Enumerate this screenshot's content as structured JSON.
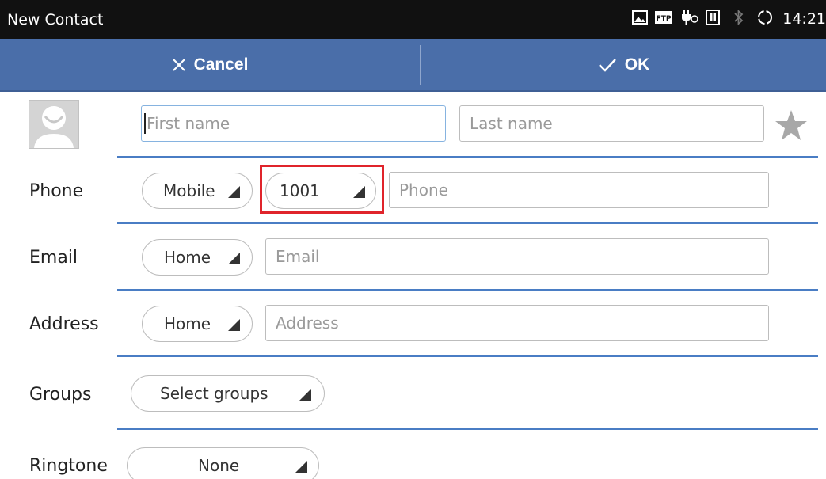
{
  "status_bar": {
    "title": "New Contact",
    "time": "14:21",
    "icons": [
      "image-icon",
      "ftp-icon",
      "usb-debug-icon",
      "sim-card-icon",
      "bluetooth-icon",
      "sync-icon"
    ]
  },
  "action_bar": {
    "cancel_label": "Cancel",
    "ok_label": "OK",
    "color": "#4a6ea9"
  },
  "name": {
    "first_placeholder": "First name",
    "last_placeholder": "Last name"
  },
  "rows": {
    "phone": {
      "label": "Phone",
      "type": "Mobile",
      "account": "1001",
      "placeholder": "Phone"
    },
    "email": {
      "label": "Email",
      "type": "Home",
      "placeholder": "Email"
    },
    "address": {
      "label": "Address",
      "type": "Home",
      "placeholder": "Address"
    },
    "groups": {
      "label": "Groups",
      "value": "Select groups"
    },
    "ringtone": {
      "label": "Ringtone",
      "value": "None"
    }
  },
  "highlight_color": "#e0242b"
}
